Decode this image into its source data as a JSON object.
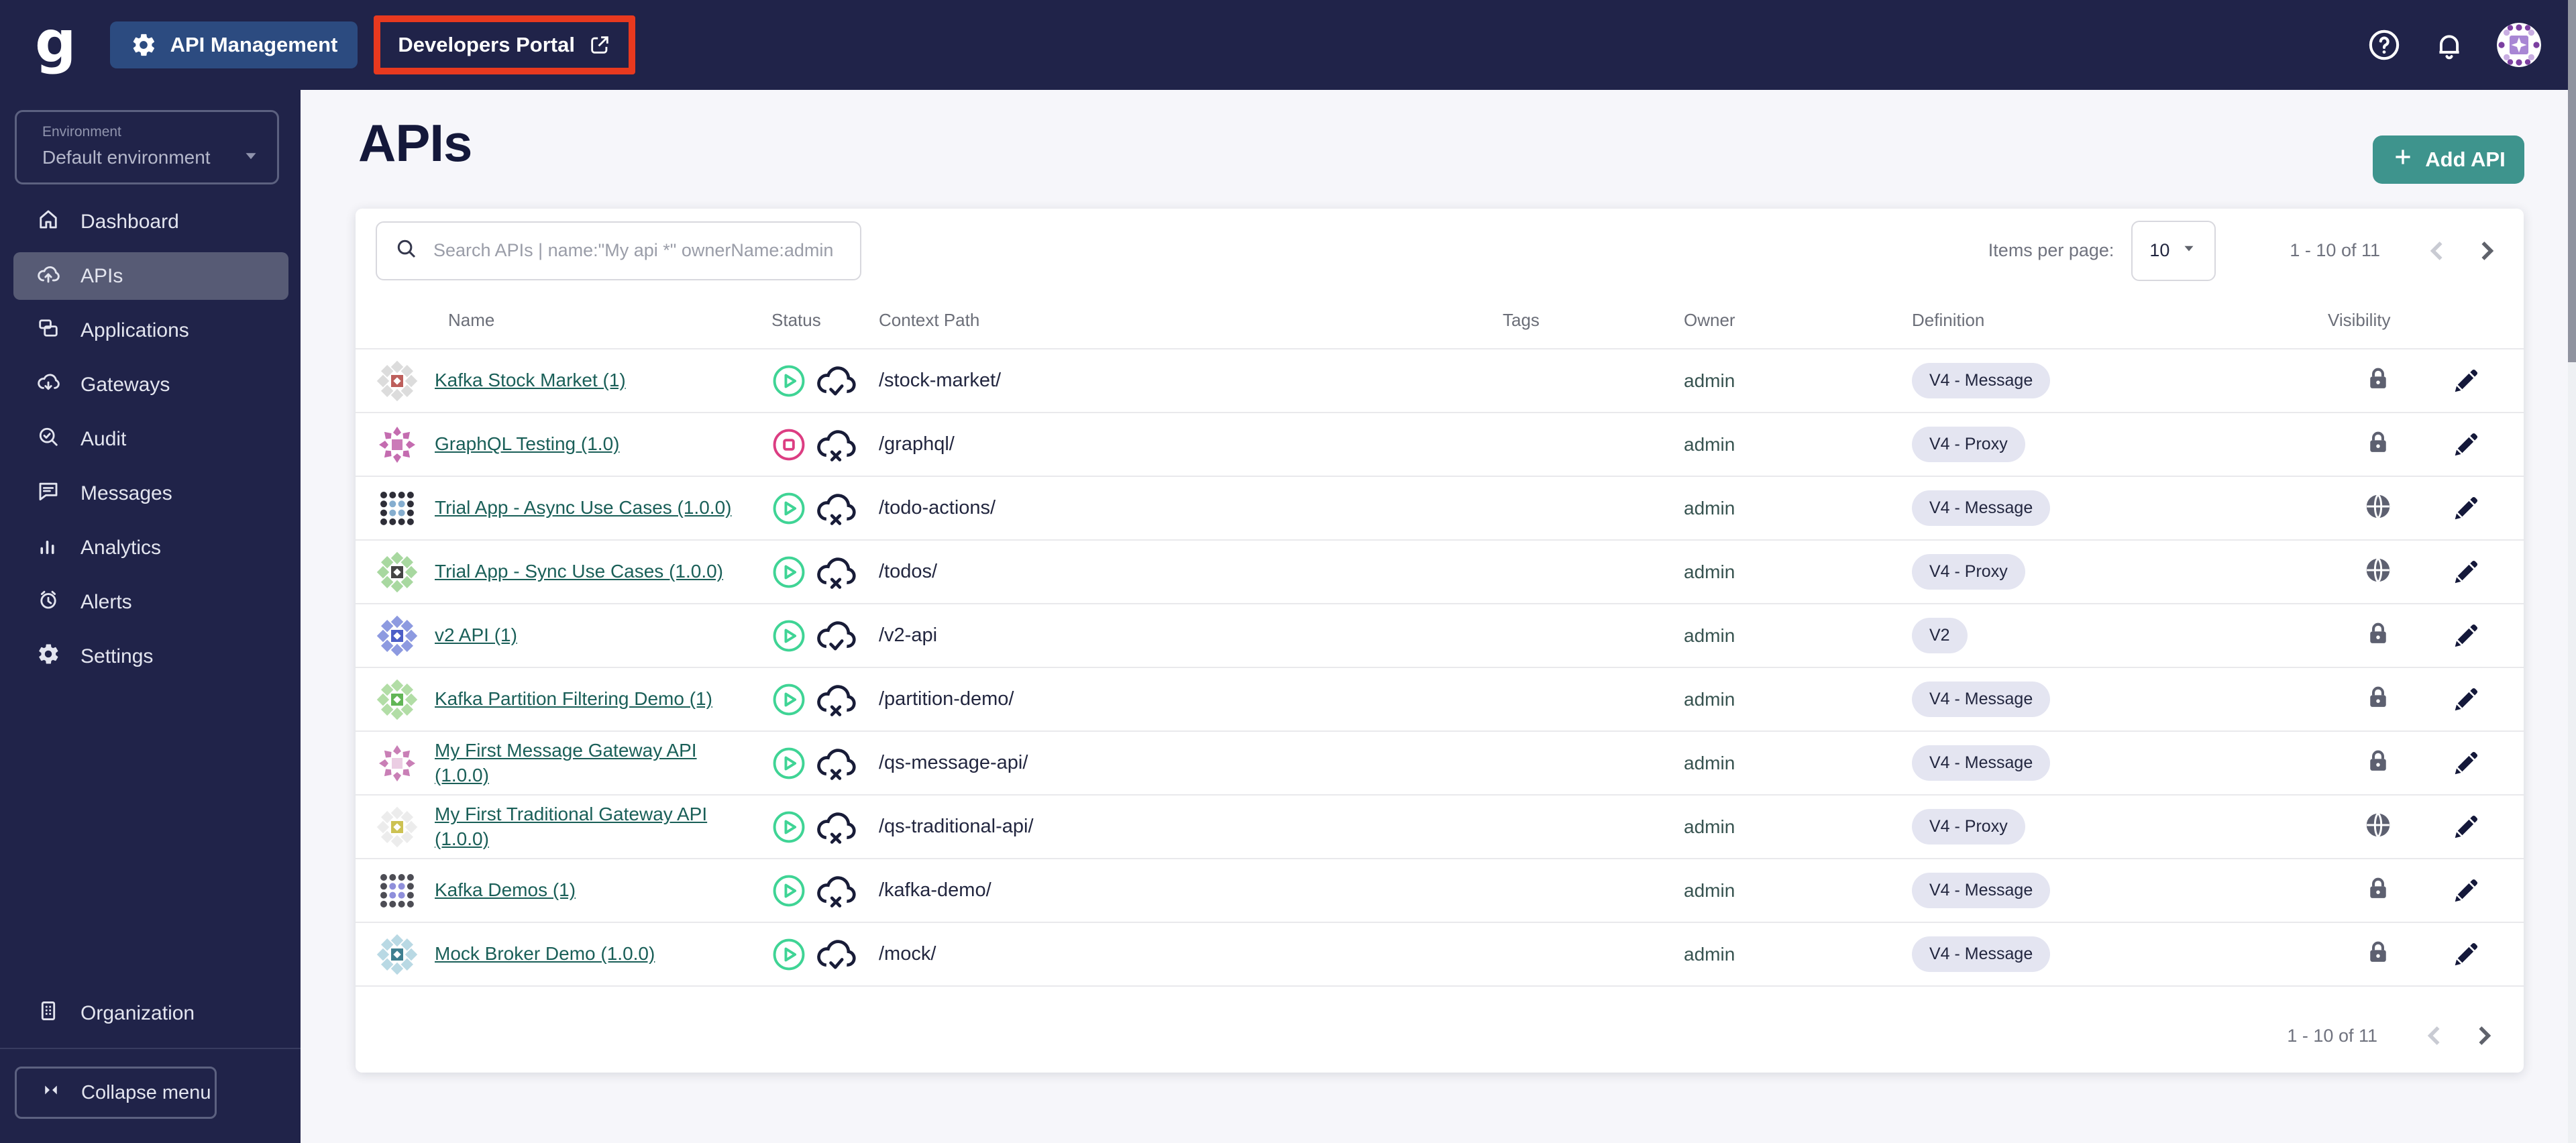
{
  "topbar": {
    "logo": "g",
    "app_switcher": "API Management",
    "portal_link": "Developers Portal"
  },
  "sidebar": {
    "environment": {
      "label": "Environment",
      "value": "Default environment"
    },
    "items": [
      {
        "label": "Dashboard",
        "icon": "home-icon",
        "active": false
      },
      {
        "label": "APIs",
        "icon": "cloud-upload-icon",
        "active": true
      },
      {
        "label": "Applications",
        "icon": "applications-icon",
        "active": false
      },
      {
        "label": "Gateways",
        "icon": "cloud-download-icon",
        "active": false
      },
      {
        "label": "Audit",
        "icon": "audit-icon",
        "active": false
      },
      {
        "label": "Messages",
        "icon": "messages-icon",
        "active": false
      },
      {
        "label": "Analytics",
        "icon": "analytics-icon",
        "active": false
      },
      {
        "label": "Alerts",
        "icon": "alerts-icon",
        "active": false
      },
      {
        "label": "Settings",
        "icon": "gear-icon",
        "active": false
      }
    ],
    "organization": {
      "label": "Organization"
    },
    "collapse_label": "Collapse menu"
  },
  "page": {
    "title": "APIs",
    "add_button": "Add API"
  },
  "toolbar": {
    "search_placeholder": "Search APIs | name:\"My api *\" ownerName:admin",
    "items_per_page_label": "Items per page:",
    "items_per_page_value": "10",
    "range": "1 - 10 of 11"
  },
  "table": {
    "columns": [
      "Name",
      "Status",
      "Context Path",
      "Tags",
      "Owner",
      "Definition",
      "Visibility"
    ],
    "rows": [
      {
        "label": "Kafka Stock Market (1)",
        "picto": "diamonds",
        "picto_colors": [
          "#dcdcdc",
          "#bd5f5c"
        ],
        "status": "started",
        "sync": "synced",
        "context_path": "/stock-market/",
        "tags": "",
        "owner": "admin",
        "definition": "V4 - Message",
        "visibility": "private"
      },
      {
        "label": "GraphQL Testing (1.0)",
        "picto": "pinwheel",
        "picto_colors": [
          "#c46cb0",
          "#b94fa0"
        ],
        "status": "stopped",
        "sync": "out-of-sync",
        "context_path": "/graphql/",
        "tags": "",
        "owner": "admin",
        "definition": "V4 - Proxy",
        "visibility": "private"
      },
      {
        "label": "Trial App - Async Use Cases (1.0.0)",
        "picto": "dots",
        "picto_colors": [
          "#2e2e38",
          "#86aecf"
        ],
        "status": "started",
        "sync": "out-of-sync",
        "context_path": "/todo-actions/",
        "tags": "",
        "owner": "admin",
        "definition": "V4 - Message",
        "visibility": "public"
      },
      {
        "label": "Trial App - Sync Use Cases (1.0.0)",
        "picto": "diamonds",
        "picto_colors": [
          "#a8d8a0",
          "#454545"
        ],
        "status": "started",
        "sync": "out-of-sync",
        "context_path": "/todos/",
        "tags": "",
        "owner": "admin",
        "definition": "V4 - Proxy",
        "visibility": "public"
      },
      {
        "label": "v2 API (1)",
        "picto": "diamonds",
        "picto_colors": [
          "#8d9ae0",
          "#4d5fc7"
        ],
        "status": "started",
        "sync": "synced",
        "context_path": "/v2-api",
        "tags": "",
        "owner": "admin",
        "definition": "V2",
        "visibility": "private"
      },
      {
        "label": "Kafka Partition Filtering Demo (1)",
        "picto": "diamonds",
        "picto_colors": [
          "#b2dda6",
          "#62b656"
        ],
        "status": "started",
        "sync": "out-of-sync",
        "context_path": "/partition-demo/",
        "tags": "",
        "owner": "admin",
        "definition": "V4 - Message",
        "visibility": "private"
      },
      {
        "label": "My First Message Gateway API (1.0.0)",
        "picto": "pinwheel",
        "picto_colors": [
          "#c97fb6",
          "#e4bcd9"
        ],
        "status": "started",
        "sync": "out-of-sync",
        "context_path": "/qs-message-api/",
        "tags": "",
        "owner": "admin",
        "definition": "V4 - Message",
        "visibility": "private"
      },
      {
        "label": "My First Traditional Gateway API (1.0.0)",
        "picto": "diamonds",
        "picto_colors": [
          "#ececec",
          "#cdc253"
        ],
        "status": "started",
        "sync": "out-of-sync",
        "context_path": "/qs-traditional-api/",
        "tags": "",
        "owner": "admin",
        "definition": "V4 - Proxy",
        "visibility": "public"
      },
      {
        "label": "Kafka Demos (1)",
        "picto": "dots",
        "picto_colors": [
          "#4d4d55",
          "#8f8fdb"
        ],
        "status": "started",
        "sync": "out-of-sync",
        "context_path": "/kafka-demo/",
        "tags": "",
        "owner": "admin",
        "definition": "V4 - Message",
        "visibility": "private"
      },
      {
        "label": "Mock Broker Demo (1.0.0)",
        "picto": "diamonds",
        "picto_colors": [
          "#b9d9e4",
          "#3f7f90"
        ],
        "status": "started",
        "sync": "synced",
        "context_path": "/mock/",
        "tags": "",
        "owner": "admin",
        "definition": "V4 - Message",
        "visibility": "private"
      }
    ]
  },
  "footer": {
    "range": "1 - 10 of 11"
  },
  "colors": {
    "topbar_bg": "#202349",
    "app_switcher_bg": "#2c4b80",
    "annotation_red": "#e8391f",
    "accent_teal": "#3e948d",
    "link_teal": "#1a5f58",
    "status_started": "#3fd495",
    "status_stopped": "#dc3d82",
    "badge_bg": "#e4e5f1"
  }
}
